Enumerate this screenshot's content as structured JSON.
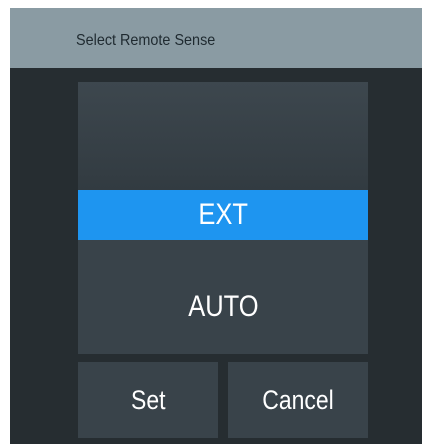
{
  "dialog": {
    "title": "Select Remote Sense"
  },
  "options": [
    {
      "label": "EXT",
      "selected": true
    },
    {
      "label": "AUTO",
      "selected": false
    }
  ],
  "buttons": {
    "set_label": "Set",
    "cancel_label": "Cancel"
  },
  "colors": {
    "title_bar": "#8a9ba3",
    "dialog_bg": "#262d31",
    "list_bg": "#39434a",
    "selected_bg": "#1e95f0",
    "text": "#ffffff"
  }
}
